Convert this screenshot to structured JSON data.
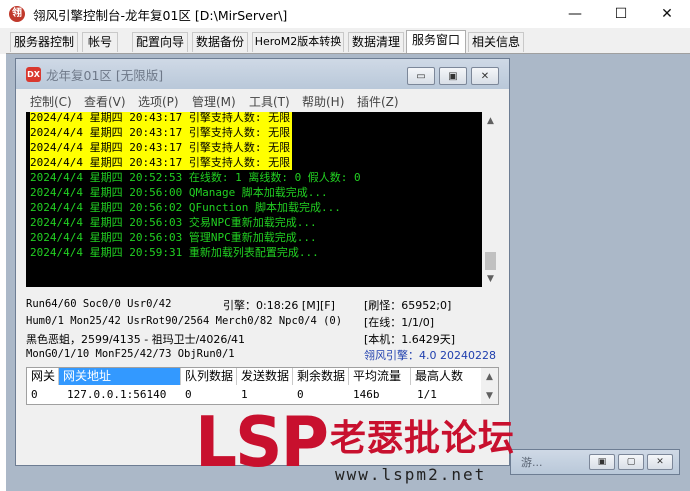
{
  "window": {
    "title": "翎风引擎控制台-龙年复01区 [D:\\MirServer\\]",
    "app_icon": "翎",
    "buttons": {
      "minimize": "—",
      "maximize": "☐",
      "close": "✕"
    }
  },
  "tabs": [
    {
      "label": "服务器控制",
      "active": false
    },
    {
      "label": "帐号",
      "active": false
    },
    {
      "label": "配置向导",
      "active": false
    },
    {
      "label": "数据备份",
      "active": false
    },
    {
      "label": "HeroM2版本转换",
      "active": false
    },
    {
      "label": "数据清理",
      "active": false
    },
    {
      "label": "服务窗口",
      "active": true
    },
    {
      "label": "相关信息",
      "active": false
    }
  ],
  "child": {
    "icon": "DX",
    "title": "龙年复01区 [无限版]",
    "buttons": {
      "minimize": "▭",
      "restore": "▣",
      "close": "✕"
    },
    "menu": [
      "控制(C)",
      "查看(V)",
      "选项(P)",
      "管理(M)",
      "工具(T)",
      "帮助(H)",
      "插件(Z)"
    ]
  },
  "console": {
    "lines": [
      {
        "text": "2024/4/4 星期四 20:43:17 引擎支持人数: 无限",
        "color": "yellow"
      },
      {
        "text": "2024/4/4 星期四 20:43:17 引擎支持人数: 无限",
        "color": "yellow"
      },
      {
        "text": "2024/4/4 星期四 20:43:17 引擎支持人数: 无限",
        "color": "yellow"
      },
      {
        "text": "2024/4/4 星期四 20:43:17 引擎支持人数: 无限",
        "color": "yellow"
      },
      {
        "text": "2024/4/4 星期四 20:52:53 在线数: 1 离线数: 0 假人数: 0",
        "color": "green"
      },
      {
        "text": "2024/4/4 星期四 20:56:00 QManage 脚本加载完成...",
        "color": "green"
      },
      {
        "text": "2024/4/4 星期四 20:56:02 QFunction 脚本加载完成...",
        "color": "green"
      },
      {
        "text": "2024/4/4 星期四 20:56:03 交易NPC重新加载完成...",
        "color": "green"
      },
      {
        "text": "2024/4/4 星期四 20:56:03 管理NPC重新加载完成...",
        "color": "green"
      },
      {
        "text": "2024/4/4 星期四 20:59:31 重新加载列表配置完成...",
        "color": "green"
      }
    ]
  },
  "status": {
    "run_line": "Run64/60 Soc0/0 Usr0/42",
    "engine_time": "引擎：0:18:26 [M][F]",
    "refresh": "[刷怪：65952;0]",
    "hum_line": "Hum0/1 Mon25/42 UsrRot90/2564 Merch0/82 Npc0/4 (0)",
    "online": "[在线：1/1/0]",
    "monster_line": "黑色恶蛆，2599/4135 - 祖玛卫士/4026/41",
    "local": "[本机：1.6429天]",
    "mon_line": "MonG0/1/10 MonF25/42/73 ObjRun0/1",
    "version": "翎风引擎：4.0 20240228"
  },
  "gateway_table": {
    "columns": [
      "网关",
      "网关地址",
      "队列数据",
      "发送数据",
      "剩余数据",
      "平均流量",
      "最高人数"
    ],
    "selected_column": 1,
    "rows": [
      [
        "0",
        "127.0.0.1:56140",
        "0",
        "1",
        "0",
        "146b",
        "1/1"
      ]
    ]
  },
  "minimized_child": {
    "label": "游...",
    "buttons": {
      "restore": "▣",
      "maximize": "▢",
      "close": "✕"
    }
  },
  "watermark": {
    "logo": "LSP",
    "name": "老瑟批论坛",
    "url": "www.lspm2.net"
  },
  "colors": {
    "console_bg": "#000000",
    "console_green": "#22d022",
    "console_highlight": "#ffff00",
    "mdi_background": "#abb8c8",
    "selection": "#3399ff",
    "watermark_red": "#c8102e"
  }
}
